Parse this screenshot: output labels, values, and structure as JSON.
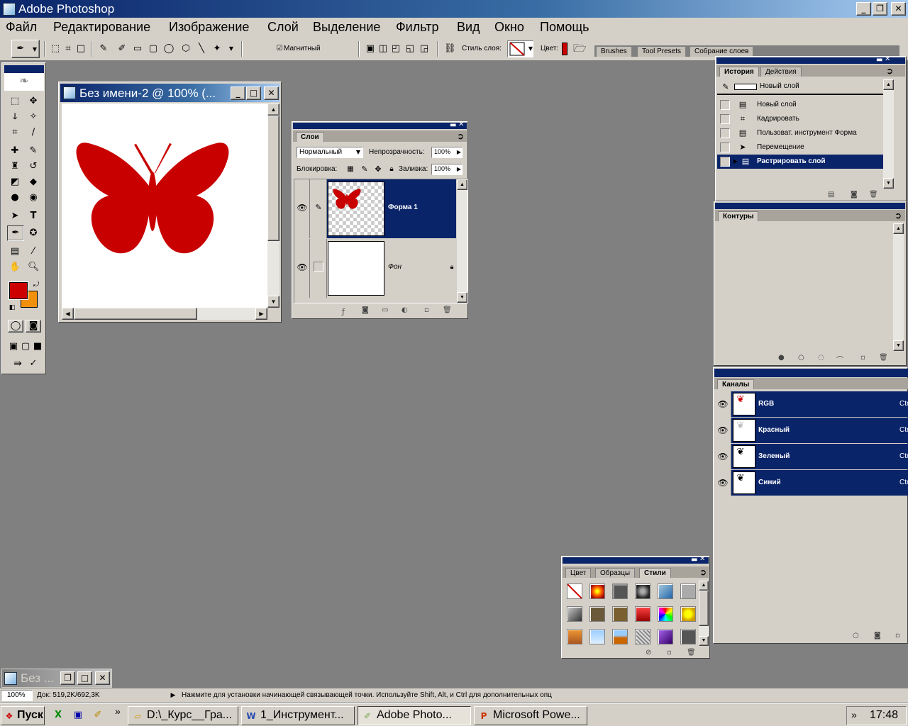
{
  "window": {
    "title": "Adobe Photoshop"
  },
  "menu": [
    "Файл",
    "Редактирование",
    "Изображение",
    "Слой",
    "Выделение",
    "Фильтр",
    "Вид",
    "Окно",
    "Помощь"
  ],
  "options": {
    "magnetic_label": "Магнитный",
    "layer_style_label": "Стиль слоя:",
    "color_label": "Цвет:",
    "palette_well": [
      "Brushes",
      "Tool Presets",
      "Собрание слоев"
    ]
  },
  "document": {
    "title": "Без имени-2 @ 100% (..."
  },
  "layers": {
    "tab": "Слои",
    "blend_mode": "Нормальный",
    "opacity_label": "Непрозрачность:",
    "opacity": "100%",
    "lock_label": "Блокировка:",
    "fill_label": "Заливка:",
    "fill": "100%",
    "items": [
      {
        "name": "Форма 1"
      },
      {
        "name": "Фон"
      }
    ]
  },
  "history": {
    "tabs": [
      "История",
      "Действия"
    ],
    "snapshot": "Новый слой",
    "items": [
      "Новый слой",
      "Кадрировать",
      "Пользоват. инструмент Форма",
      "Перемещение",
      "Растрировать слой"
    ]
  },
  "paths": {
    "tab": "Контуры"
  },
  "channels": {
    "tab": "Каналы",
    "items": [
      {
        "name": "RGB",
        "shortcut": "Ctr"
      },
      {
        "name": "Красный",
        "shortcut": "Ctr"
      },
      {
        "name": "Зеленый",
        "shortcut": "Ctr"
      },
      {
        "name": "Синий",
        "shortcut": "Ctr"
      }
    ]
  },
  "styles": {
    "tabs": [
      "Цвет",
      "Образцы",
      "Стили"
    ]
  },
  "minimized": {
    "title": "Без ..."
  },
  "status": {
    "zoom": "100%",
    "doc": "Док: 519,2K/692,3K",
    "hint": "Нажмите для установки начинающей связывающей точки.  Используйте Shift, Alt, и Ctrl для дополнительных опц"
  },
  "taskbar": {
    "start": "Пуск",
    "items": [
      "D:\\_Курс__Гра...",
      "1_Инструмент...",
      "Adobe Photo...",
      "Microsoft Powe..."
    ],
    "clock": "17:48",
    "chevron": "»"
  },
  "colors": {
    "accent": "#0a246a",
    "foreground": "#cc0000",
    "background": "#f0900c",
    "butterfly": "#c80000"
  }
}
